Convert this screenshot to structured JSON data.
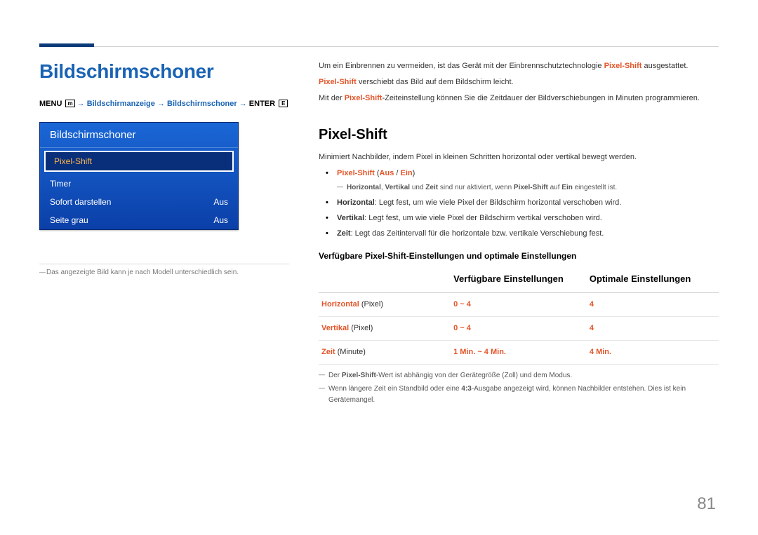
{
  "heading": "Bildschirmschoner",
  "menu_path": {
    "prefix": "MENU",
    "icon1": "m",
    "seg1": "Bildschirmanzeige",
    "seg2": "Bildschirmschoner",
    "suffix": "ENTER",
    "icon2": "E"
  },
  "osd": {
    "title": "Bildschirmschoner",
    "rows": [
      {
        "label": "Pixel-Shift",
        "value": "",
        "selected": true
      },
      {
        "label": "Timer",
        "value": "",
        "selected": false
      },
      {
        "label": "Sofort darstellen",
        "value": "Aus",
        "selected": false
      },
      {
        "label": "Seite grau",
        "value": "Aus",
        "selected": false
      }
    ]
  },
  "left_footnote": "Das angezeigte Bild kann je nach Modell unterschiedlich sein.",
  "intro": {
    "p1_pre": "Um ein Einbrennen zu vermeiden, ist das Gerät mit der Einbrennschutztechnologie ",
    "p1_bold": "Pixel-Shift",
    "p1_post": " ausgestattet.",
    "p2_bold": "Pixel-Shift",
    "p2_post": " verschiebt das Bild auf dem Bildschirm leicht.",
    "p3_pre": "Mit der ",
    "p3_bold": "Pixel-Shift",
    "p3_post": "-Zeiteinstellung können Sie die Zeitdauer der Bildverschiebungen in Minuten programmieren."
  },
  "section": {
    "title": "Pixel-Shift",
    "lead": "Minimiert Nachbilder, indem Pixel in kleinen Schritten horizontal oder vertikal bewegt werden.",
    "bullet1": {
      "b": "Pixel-Shift",
      "paren_open": " (",
      "aus": "Aus",
      "slash": " / ",
      "ein": "Ein",
      "paren_close": ")"
    },
    "note1": {
      "b1": "Horizontal",
      "sep1": ", ",
      "b2": "Vertikal",
      "mid": " und ",
      "b3": "Zeit",
      "mid2": " sind nur aktiviert, wenn ",
      "b4": "Pixel-Shift",
      "mid3": " auf ",
      "b5": "Ein",
      "tail": " eingestellt ist."
    },
    "bullet2": {
      "b": "Horizontal",
      "text": ": Legt fest, um wie viele Pixel der Bildschirm horizontal verschoben wird."
    },
    "bullet3": {
      "b": "Vertikal",
      "text": ": Legt fest, um wie viele Pixel der Bildschirm vertikal verschoben wird."
    },
    "bullet4": {
      "b": "Zeit",
      "text": ": Legt das Zeitintervall für die horizontale bzw. vertikale Verschiebung fest."
    },
    "sub_h3": "Verfügbare Pixel-Shift-Einstellungen und optimale Einstellungen",
    "footnote1": {
      "pre": "Der ",
      "b": "Pixel-Shift",
      "post": "-Wert ist abhängig von der Gerätegröße (Zoll) und dem Modus."
    },
    "footnote2": {
      "pre": "Wenn längere Zeit ein Standbild oder eine ",
      "b": "4:3",
      "post": "-Ausgabe angezeigt wird, können Nachbilder entstehen. Dies ist kein Gerätemangel."
    }
  },
  "chart_data": {
    "type": "table",
    "columns": [
      "",
      "Verfügbare Einstellungen",
      "Optimale Einstellungen"
    ],
    "rows": [
      {
        "param": "Horizontal",
        "unit": "(Pixel)",
        "available": "0 ~ 4",
        "optimal": "4"
      },
      {
        "param": "Vertikal",
        "unit": "(Pixel)",
        "available": "0 ~ 4",
        "optimal": "4"
      },
      {
        "param": "Zeit",
        "unit": "(Minute)",
        "available": "1 Min. ~ 4 Min.",
        "optimal": "4 Min."
      }
    ]
  },
  "page_number": "81"
}
